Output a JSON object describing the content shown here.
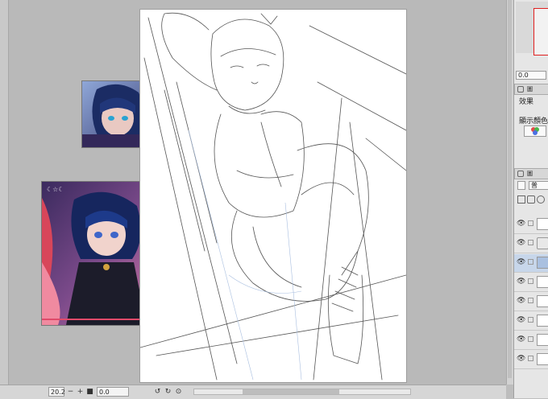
{
  "status_bar": {
    "zoom_value": "20.2",
    "zoom_out_label": "−",
    "zoom_in_label": "+",
    "rotation_value": "0.0"
  },
  "right_panel": {
    "nav_angle_value": "0.0",
    "effect_label": "效果",
    "display_color_label": "顯示顏色",
    "panel_tab_1": "圖",
    "panel_tab_2": "圖",
    "blend_mode_value": "普"
  },
  "layers": [
    {
      "thumb": "checker"
    },
    {
      "thumb": "folder"
    },
    {
      "thumb": "selected"
    },
    {
      "thumb": "blank"
    },
    {
      "thumb": "blank"
    },
    {
      "thumb": "blank"
    },
    {
      "thumb": "checker"
    },
    {
      "thumb": "white"
    }
  ],
  "colors": {
    "workspace": "#b9b9b9",
    "canvas": "#ffffff",
    "navigator_frame": "#e02020",
    "selected_layer": "#c7d6ea"
  },
  "icons": [
    "eye-icon",
    "lock-icon",
    "zoom-out-icon",
    "zoom-in-icon",
    "rotate-left-icon",
    "rotate-right-icon",
    "reset-rotation-icon",
    "color-wheel-icon",
    "folder-icon",
    "pen-icon"
  ]
}
